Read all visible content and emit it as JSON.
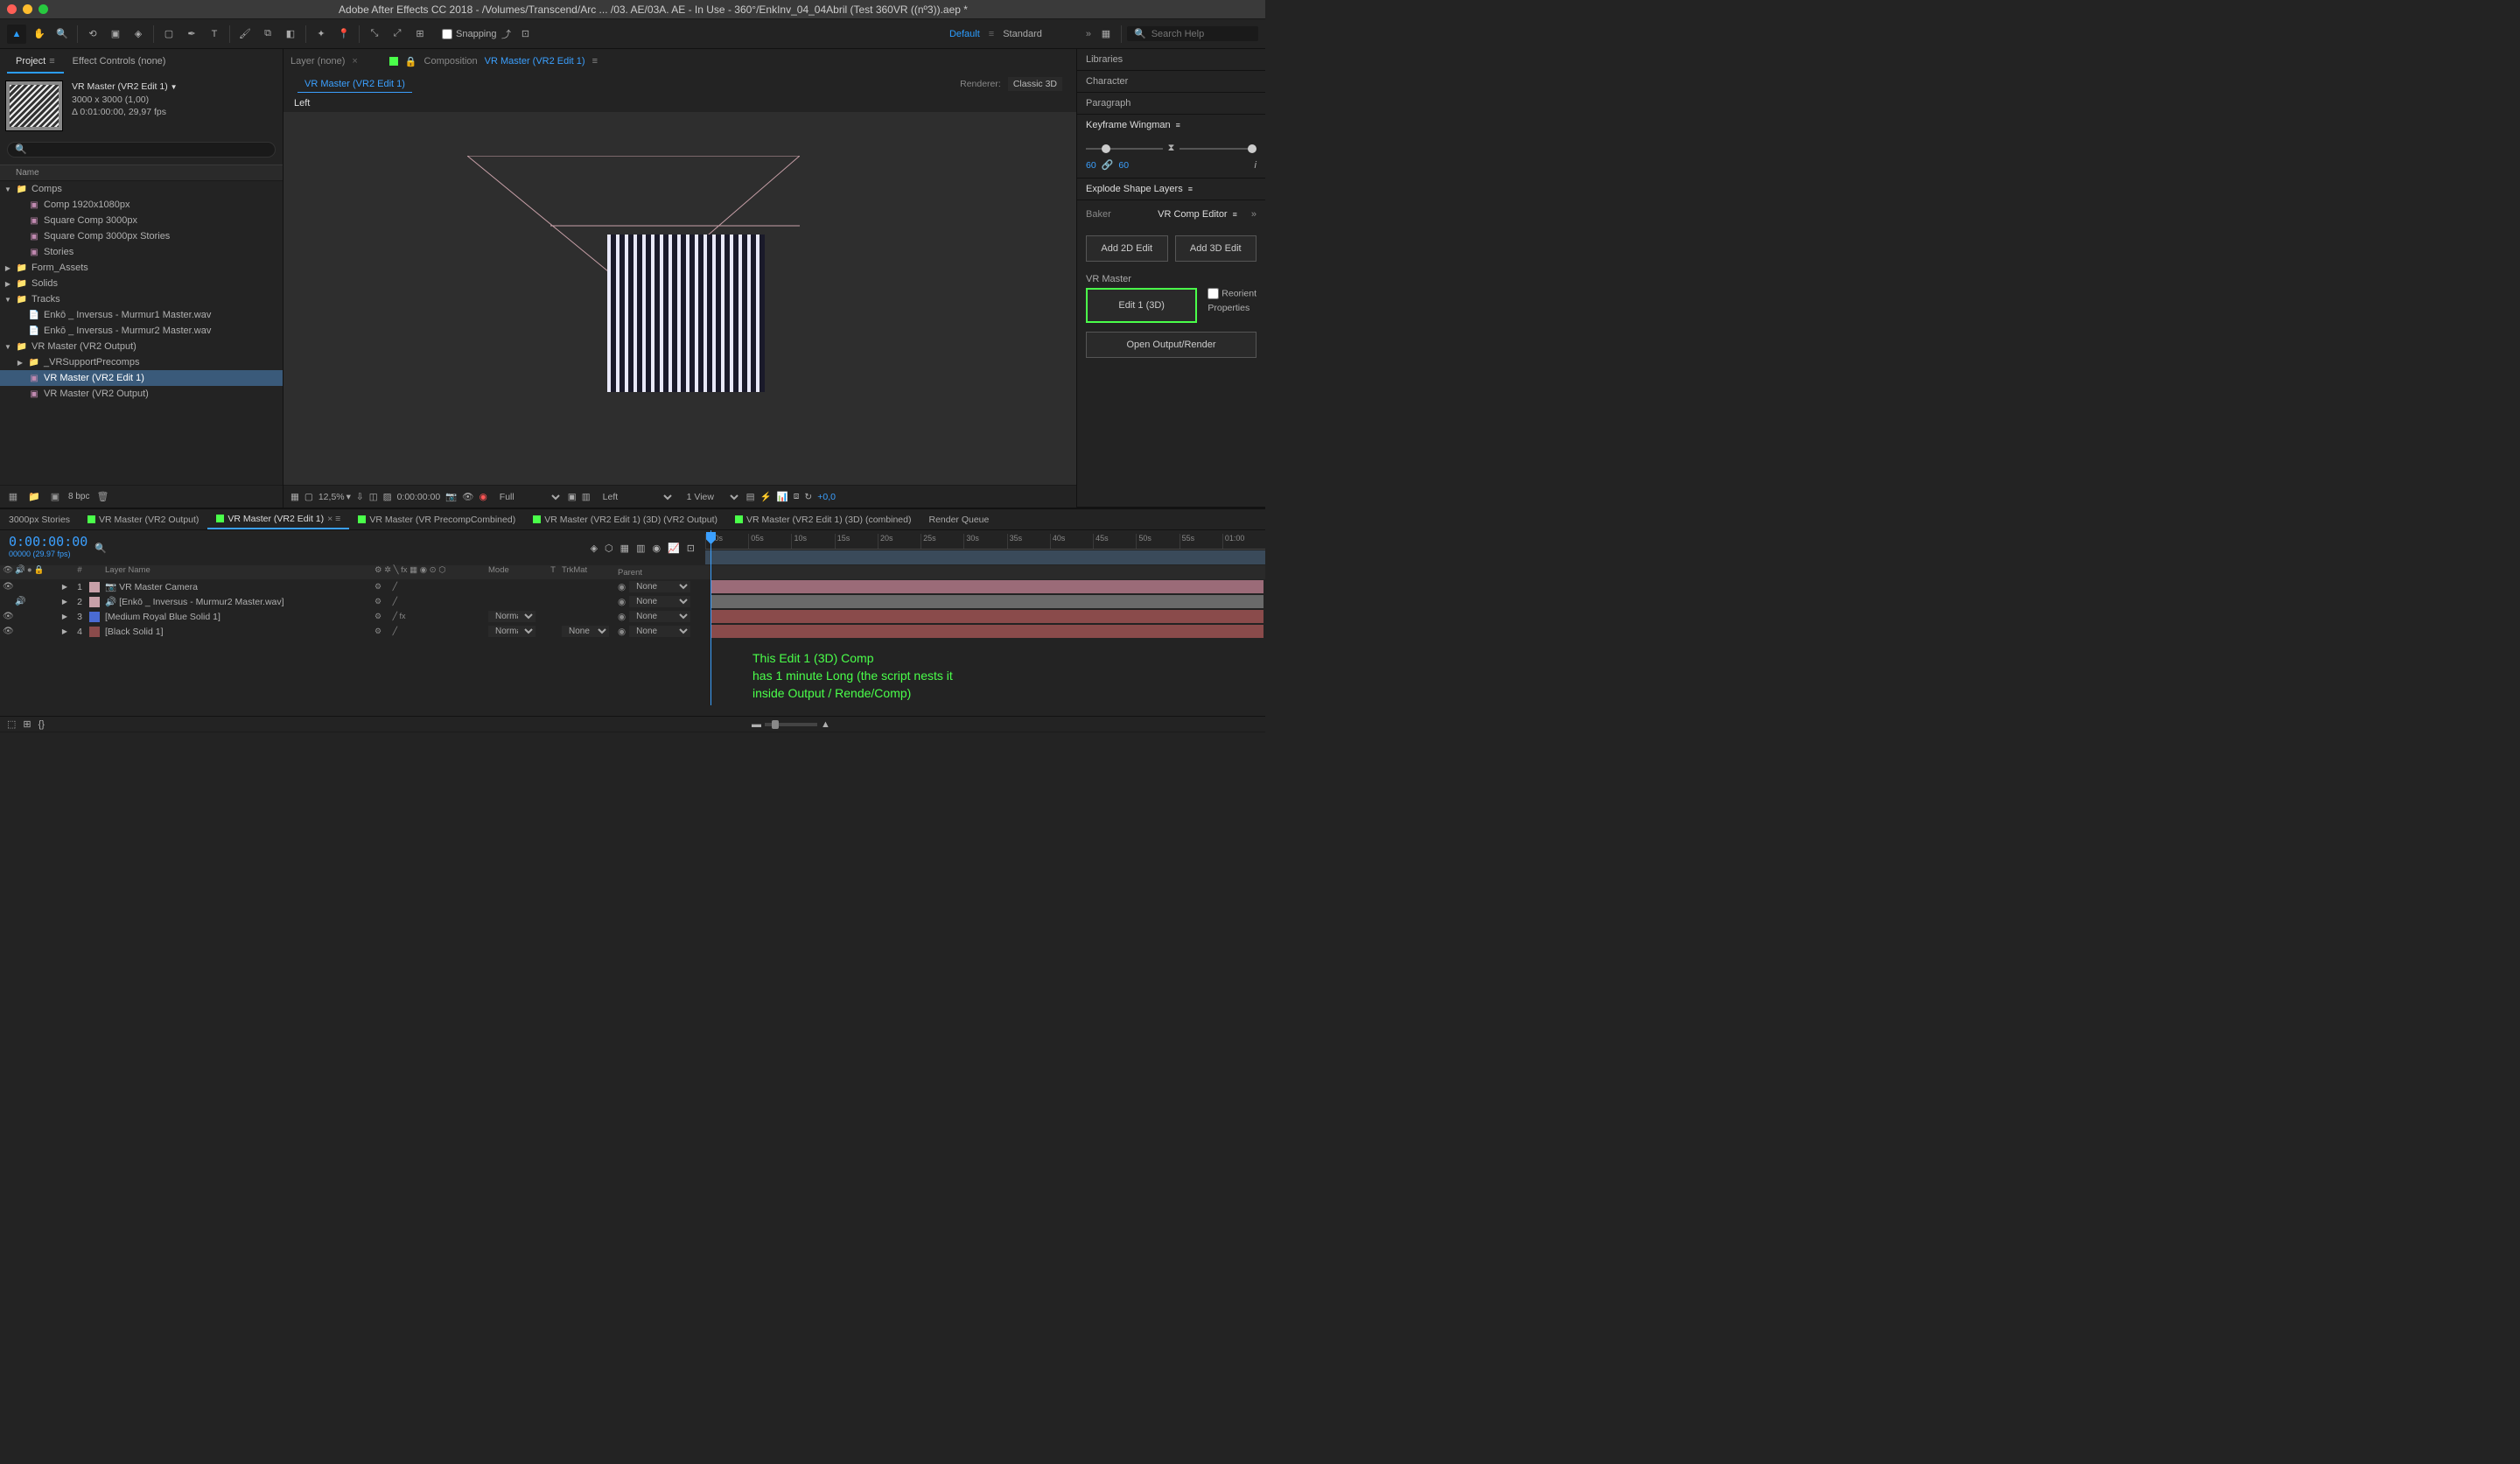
{
  "window": {
    "title": "Adobe After Effects CC 2018 - /Volumes/Transcend/Arc ... /03. AE/03A. AE - In Use - 360°/EnkInv_04_04Abril (Test 360VR ((nº3)).aep *"
  },
  "toolbar": {
    "snapping": "Snapping",
    "workspace_default": "Default",
    "workspace_standard": "Standard",
    "search_placeholder": "Search Help"
  },
  "project": {
    "tab_project": "Project",
    "tab_effect_controls": "Effect Controls (none)",
    "comp_name": "VR Master (VR2 Edit 1)",
    "comp_dims": "3000 x 3000 (1,00)",
    "comp_dur": "Δ 0:01:00:00, 29,97 fps",
    "header_name": "Name",
    "bpc": "8 bpc",
    "tree": [
      {
        "type": "folder",
        "name": "Comps",
        "depth": 0,
        "open": true
      },
      {
        "type": "comp",
        "name": "Comp 1920x1080px",
        "depth": 1
      },
      {
        "type": "comp",
        "name": "Square Comp 3000px",
        "depth": 1
      },
      {
        "type": "comp",
        "name": "Square Comp 3000px Stories",
        "depth": 1
      },
      {
        "type": "comp",
        "name": "Stories",
        "depth": 1
      },
      {
        "type": "folder",
        "name": "Form_Assets",
        "depth": 0,
        "open": false
      },
      {
        "type": "folder",
        "name": "Solids",
        "depth": 0,
        "open": false
      },
      {
        "type": "folder",
        "name": "Tracks",
        "depth": 0,
        "open": true
      },
      {
        "type": "audio",
        "name": "Enkō _ Inversus - Murmur1 Master.wav",
        "depth": 1
      },
      {
        "type": "audio",
        "name": "Enkō _ Inversus - Murmur2 Master.wav",
        "depth": 1
      },
      {
        "type": "folder",
        "name": "VR Master (VR2 Output)",
        "depth": 0,
        "open": true
      },
      {
        "type": "folder",
        "name": "_VRSupportPrecomps",
        "depth": 1,
        "open": false
      },
      {
        "type": "comp",
        "name": "VR Master (VR2 Edit 1)",
        "depth": 1,
        "selected": true
      },
      {
        "type": "comp",
        "name": "VR Master (VR2 Output)",
        "depth": 1
      }
    ]
  },
  "viewer": {
    "tab_layer": "Layer (none)",
    "tab_comp_prefix": "Composition",
    "tab_comp_name": "VR Master (VR2 Edit 1)",
    "breadcrumb": "VR Master (VR2 Edit 1)",
    "renderer_lbl": "Renderer:",
    "renderer_val": "Classic 3D",
    "view_label": "Left",
    "zoom": "12,5%",
    "timecode": "0:00:00:00",
    "resolution": "Full",
    "view_sel": "Left",
    "view_count": "1 View",
    "exposure": "+0,0"
  },
  "right": {
    "libraries": "Libraries",
    "character": "Character",
    "paragraph": "Paragraph",
    "kw_title": "Keyframe Wingman",
    "kw_left": "60",
    "kw_right": "60",
    "esl_title": "Explode Shape Layers",
    "baker": "Baker",
    "vr_tab": "VR Comp Editor",
    "add_2d": "Add 2D Edit",
    "add_3d": "Add 3D Edit",
    "vr_master": "VR Master",
    "edit1": "Edit 1 (3D)",
    "reorient": "Reorient",
    "properties": "Properties",
    "open_output": "Open Output/Render"
  },
  "timeline": {
    "tabs": [
      {
        "label": "3000px Stories",
        "color": null
      },
      {
        "label": "VR Master (VR2 Output)",
        "color": "#4aff4a"
      },
      {
        "label": "VR Master (VR2 Edit 1)",
        "color": "#4aff4a",
        "active": true
      },
      {
        "label": "VR Master (VR PrecompCombined)",
        "color": "#4aff4a"
      },
      {
        "label": "VR Master (VR2 Edit 1) (3D) (VR2 Output)",
        "color": "#4aff4a"
      },
      {
        "label": "VR Master (VR2 Edit 1) (3D) (combined)",
        "color": "#4aff4a"
      },
      {
        "label": "Render Queue",
        "color": null
      }
    ],
    "timecode": "0:00:00:00",
    "fps_line": "00000 (29.97 fps)",
    "cols": {
      "layer_name": "Layer Name",
      "mode": "Mode",
      "t": "T",
      "trkmat": "TrkMat",
      "parent": "Parent"
    },
    "ticks": [
      ":00s",
      "05s",
      "10s",
      "15s",
      "20s",
      "25s",
      "30s",
      "35s",
      "40s",
      "45s",
      "50s",
      "55s",
      "01:00"
    ],
    "layers": [
      {
        "num": 1,
        "color": "#c8a0a8",
        "name": "VR Master Camera",
        "icon": "📷",
        "mode": "",
        "trk": "",
        "parent": "None",
        "bar": "pink",
        "eye": true,
        "audio": false
      },
      {
        "num": 2,
        "color": "#c8a0a8",
        "name": "[Enkō _ Inversus - Murmur2 Master.wav]",
        "icon": "🔊",
        "mode": "",
        "trk": "",
        "parent": "None",
        "bar": "gray",
        "eye": false,
        "audio": true
      },
      {
        "num": 3,
        "color": "#4a6bd4",
        "name": "[Medium Royal Blue Solid 1]",
        "icon": "",
        "mode": "Normal",
        "trk": "",
        "parent": "None",
        "bar": "red",
        "eye": true,
        "audio": false,
        "fx": true
      },
      {
        "num": 4,
        "color": "#8a4b4b",
        "name": "[Black Solid 1]",
        "icon": "",
        "mode": "Normal",
        "trk": "None",
        "parent": "None",
        "bar": "red",
        "eye": true,
        "audio": false
      }
    ],
    "annotation": "This Edit 1 (3D) Comp\nhas 1 minute Long (the script nests it\ninside Output / Rende/Comp)"
  }
}
